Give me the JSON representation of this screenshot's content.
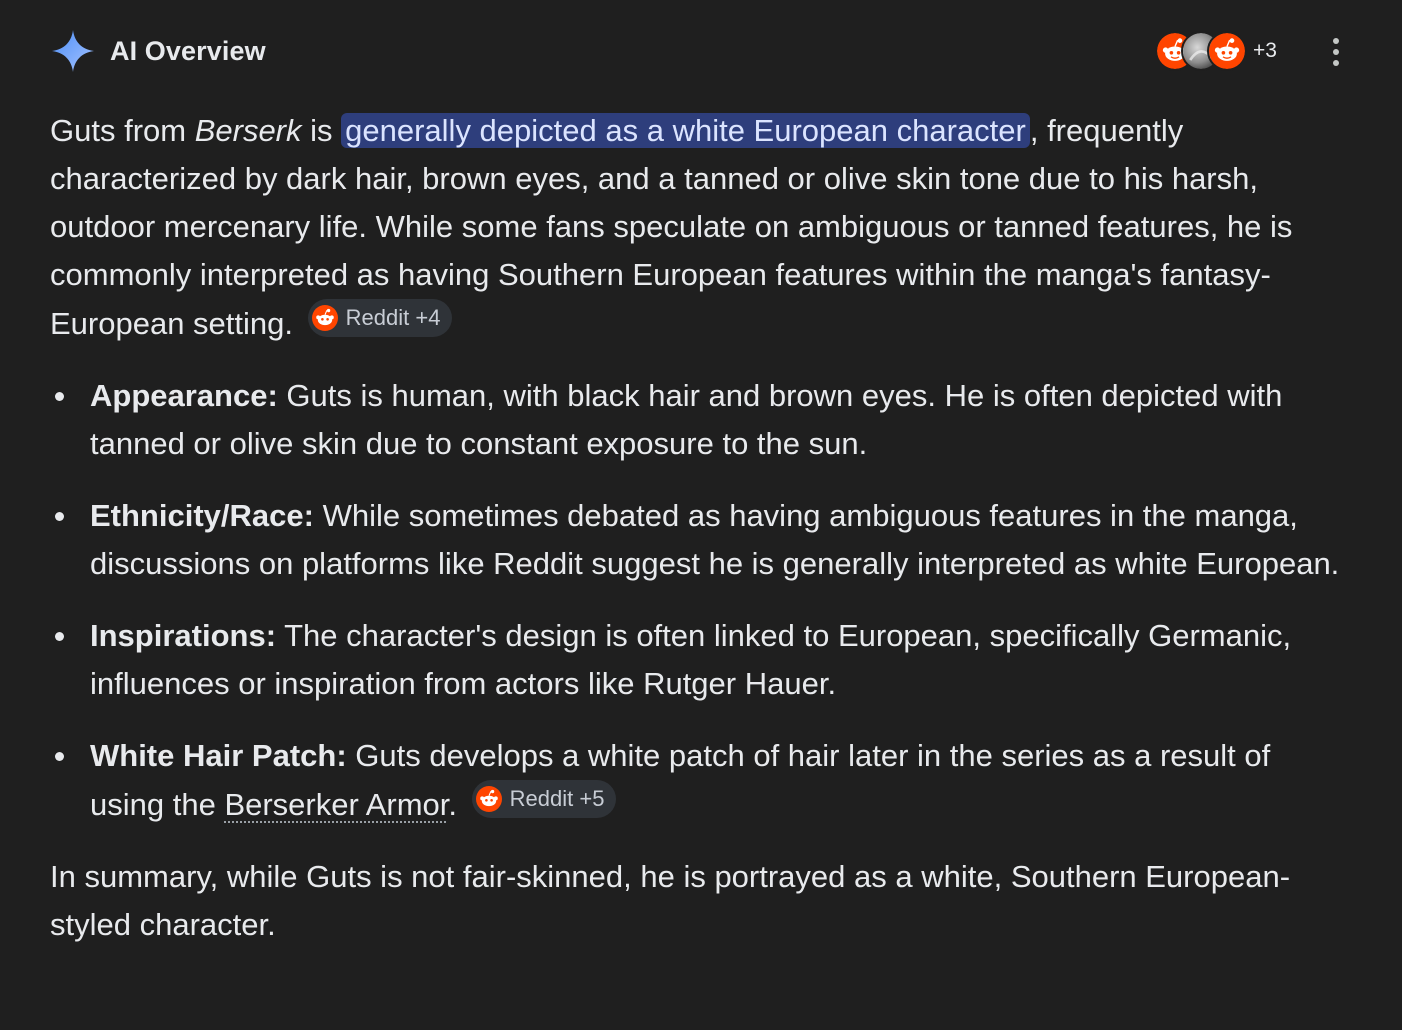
{
  "header": {
    "title": "AI Overview",
    "sparkle_icon": "gemini-sparkle-icon",
    "sparkle_color": "#4c8df6",
    "source_icons": [
      "reddit-icon",
      "gray-avatar-icon",
      "reddit-icon"
    ],
    "more_sources": "+3",
    "menu_icon": "more-vert-icon"
  },
  "intro": {
    "part1": "Guts from ",
    "series": "Berserk",
    "part2": " is ",
    "highlight": "generally depicted as a white European character",
    "part3": ", frequently characterized by dark hair, brown eyes, and a tanned or olive skin tone due to his harsh, outdoor mercenary life. While some fans speculate on ambiguous or tanned features, he is commonly interpreted as having Southern European features within the manga's fantasy-European setting.",
    "chip": {
      "label": "Reddit +4",
      "icon": "reddit-icon"
    }
  },
  "bullets": [
    {
      "term": "Appearance:",
      "text": " Guts is human, with black hair and brown eyes. He is often depicted with tanned or olive skin due to constant exposure to the sun."
    },
    {
      "term": "Ethnicity/Race:",
      "text": " While sometimes debated as having ambiguous features in the manga, discussions on platforms like Reddit suggest he is generally interpreted as white European."
    },
    {
      "term": "Inspirations:",
      "text": " The character's design is often linked to European, specifically Germanic, influences or inspiration from actors like Rutger Hauer."
    },
    {
      "term": "White Hair Patch:",
      "text": " Guts develops a white patch of hair later in the series as a result of using the ",
      "link": "Berserker Armor",
      "after": ".",
      "chip": {
        "label": "Reddit +5",
        "icon": "reddit-icon"
      }
    }
  ],
  "summary": "In summary, while Guts is not fair-skinned, he is portrayed as a white, Southern European-styled character.",
  "colors": {
    "background": "#1f1f1f",
    "text": "#e8eaed",
    "highlight_bg": "#2e3e7c",
    "chip_bg": "#2f3338",
    "reddit": "#ff4500"
  }
}
